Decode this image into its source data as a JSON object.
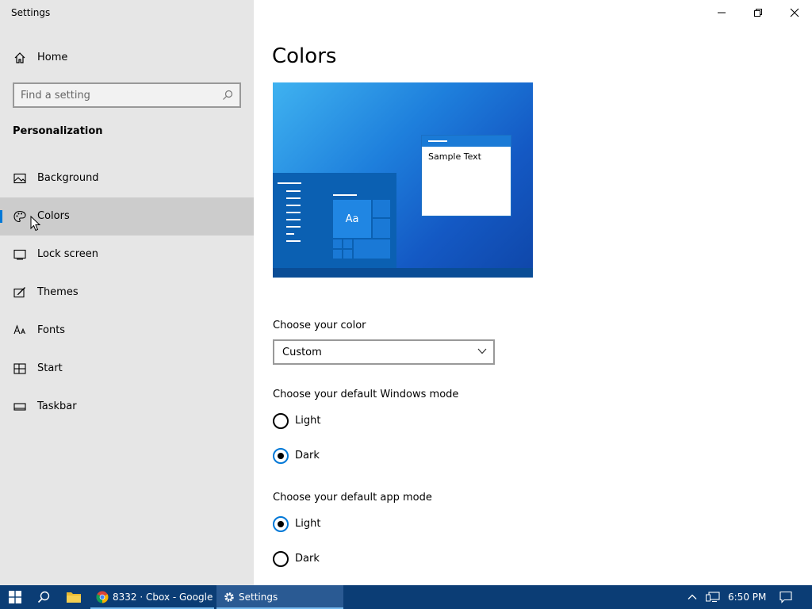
{
  "window": {
    "title": "Settings",
    "controls": [
      "minimize",
      "restore",
      "close"
    ]
  },
  "sidebar": {
    "home_label": "Home",
    "search_placeholder": "Find a setting",
    "section_title": "Personalization",
    "items": [
      {
        "label": "Background",
        "icon": "picture-icon"
      },
      {
        "label": "Colors",
        "icon": "palette-icon",
        "selected": true
      },
      {
        "label": "Lock screen",
        "icon": "lock-screen-icon"
      },
      {
        "label": "Themes",
        "icon": "themes-icon"
      },
      {
        "label": "Fonts",
        "icon": "fonts-icon"
      },
      {
        "label": "Start",
        "icon": "start-icon"
      },
      {
        "label": "Taskbar",
        "icon": "taskbar-icon"
      }
    ]
  },
  "main": {
    "title": "Colors",
    "preview": {
      "sample_text": "Sample Text",
      "tile_text": "Aa"
    },
    "choose_color": {
      "label": "Choose your color",
      "value": "Custom"
    },
    "windows_mode": {
      "label": "Choose your default Windows mode",
      "options": [
        {
          "label": "Light",
          "checked": false
        },
        {
          "label": "Dark",
          "checked": true
        }
      ]
    },
    "app_mode": {
      "label": "Choose your default app mode",
      "options": [
        {
          "label": "Light",
          "checked": true
        },
        {
          "label": "Dark",
          "checked": false
        }
      ]
    }
  },
  "taskbar": {
    "apps": [
      {
        "label": "8332 · Cbox - Google ...",
        "icon": "chrome-icon",
        "active": false
      },
      {
        "label": "Settings",
        "icon": "gear-icon",
        "active": true
      }
    ],
    "clock": "6:50 PM"
  },
  "colors": {
    "accent": "#0078d7",
    "sidebar_bg": "#e6e6e6",
    "selected_bg": "#cccccc",
    "taskbar_bg": "#0b3d75"
  }
}
